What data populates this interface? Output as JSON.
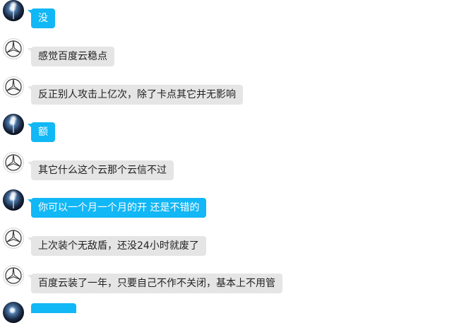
{
  "chat": {
    "messages": [
      {
        "sender": "self",
        "avatar_icon": "space-light-avatar-icon",
        "text": "没"
      },
      {
        "sender": "other",
        "avatar_icon": "mercedes-star-avatar-icon",
        "text": "感觉百度云稳点"
      },
      {
        "sender": "other",
        "avatar_icon": "mercedes-star-avatar-icon",
        "text": "反正别人攻击上亿次，除了卡点其它并无影响"
      },
      {
        "sender": "self",
        "avatar_icon": "space-light-avatar-icon",
        "text": "额"
      },
      {
        "sender": "other",
        "avatar_icon": "mercedes-star-avatar-icon",
        "text": "其它什么这个云那个云信不过"
      },
      {
        "sender": "self",
        "avatar_icon": "space-light-avatar-icon",
        "text": "你可以一个月一个月的开 还是不错的"
      },
      {
        "sender": "other",
        "avatar_icon": "mercedes-star-avatar-icon",
        "text": "上次装个无敌盾，还没24小时就废了"
      },
      {
        "sender": "other",
        "avatar_icon": "mercedes-star-avatar-icon",
        "text": "百度云装了一年，只要自己不作不关闭，基本上不用管"
      }
    ]
  },
  "colors": {
    "self_bubble": "#12b7f5",
    "other_bubble": "#e5e5e5",
    "self_text": "#ffffff",
    "other_text": "#222222"
  }
}
